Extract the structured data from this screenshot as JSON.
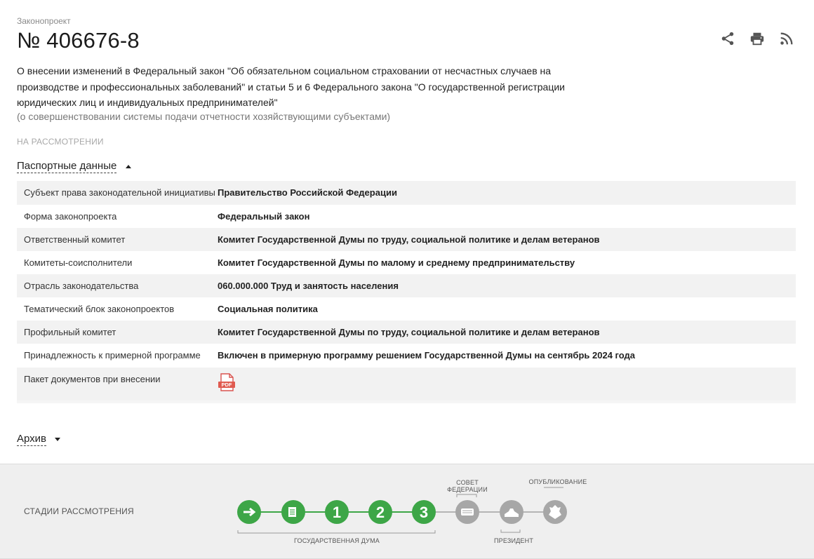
{
  "header": {
    "kind": "Законопроект",
    "number": "№ 406676-8",
    "description": "О внесении изменений в Федеральный закон \"Об обязательном социальном страховании от несчастных случаев на производстве и профессиональных заболеваний\" и статьи 5 и 6 Федерального закона \"О государственной регистрации юридических лиц и индивидуальных предпринимателей\"",
    "subdescription": "(о совершенствовании системы подачи отчетности хозяйствующими субъектами)",
    "status": "НА РАССМОТРЕНИИ",
    "actions": [
      "share-icon",
      "print-icon",
      "rss-icon"
    ]
  },
  "passport": {
    "title": "Паспортные данные",
    "rows": [
      {
        "key": "Субъект права законодательной инициативы",
        "value": "Правительство Российской Федерации"
      },
      {
        "key": "Форма законопроекта",
        "value": "Федеральный закон"
      },
      {
        "key": "Ответственный комитет",
        "value": "Комитет Государственной Думы по труду, социальной политике и делам ветеранов"
      },
      {
        "key": "Комитеты-соисполнители",
        "value": "Комитет Государственной Думы по малому и среднему предпринимательству"
      },
      {
        "key": "Отрасль законодательства",
        "value": "060.000.000 Труд и занятость населения"
      },
      {
        "key": "Тематический блок законопроектов",
        "value": "Социальная политика"
      },
      {
        "key": "Профильный комитет",
        "value": "Комитет Государственной Думы по труду, социальной политике и делам ветеранов"
      },
      {
        "key": "Принадлежность к примерной программе",
        "value": "Включен в примерную программу решением Государственной Думы на сентябрь 2024 года"
      },
      {
        "key": "Пакет документов при внесении",
        "value": ""
      }
    ],
    "pdf_label": "PDF"
  },
  "archive": {
    "title": "Архив"
  },
  "stages": {
    "title": "СТАДИИ РАССМОТРЕНИЯ",
    "duma_label": "ГОСУДАРСТВЕННАЯ ДУМА",
    "council_label_1": "СОВЕТ",
    "council_label_2": "ФЕДЕРАЦИИ",
    "president_label": "ПРЕЗИДЕНТ",
    "publication_label": "ОПУБЛИКОВАНИЕ",
    "steps": [
      {
        "label": "",
        "state": "done"
      },
      {
        "label": "",
        "state": "done"
      },
      {
        "label": "1",
        "state": "done"
      },
      {
        "label": "2",
        "state": "done"
      },
      {
        "label": "3",
        "state": "done"
      },
      {
        "label": "",
        "state": "pending"
      },
      {
        "label": "",
        "state": "pending"
      },
      {
        "label": "",
        "state": "pending"
      }
    ],
    "colors": {
      "done": "#3da647",
      "pending": "#a7a7a7",
      "line_done": "#3da647",
      "line_pending": "#b5b5b5"
    }
  }
}
